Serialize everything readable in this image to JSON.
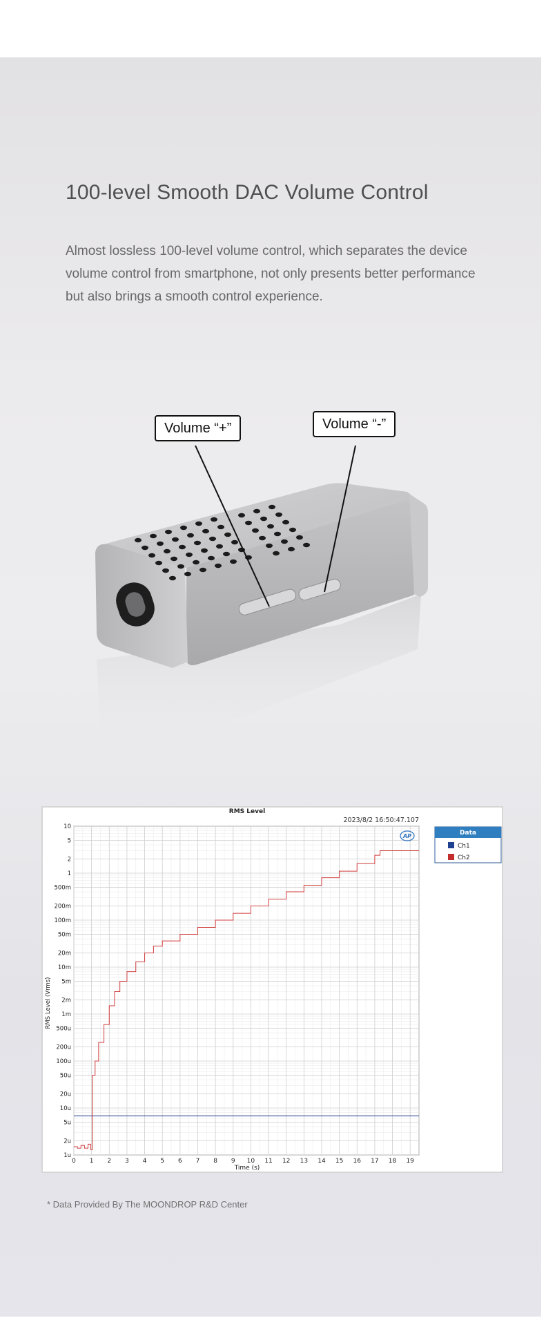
{
  "headline": "100-level Smooth DAC Volume Control",
  "description": "Almost lossless 100-level volume control, which separates the device volume control from smartphone, not only presents better performance but also brings a smooth control experience.",
  "callouts": {
    "plus": "Volume “+”",
    "minus": "Volume “-”"
  },
  "chart_data": {
    "type": "line",
    "title": "RMS Level",
    "timestamp": "2023/8/2 16:50:47.107",
    "xlabel": "Time (s)",
    "ylabel": "RMS Level (Vrms)",
    "xlim": [
      0,
      19.5
    ],
    "ylim": [
      1e-06,
      10
    ],
    "yscale": "log",
    "grid": true,
    "legend_title": "Data",
    "legend_position": "right",
    "x_ticks": [
      0,
      1,
      2,
      3,
      4,
      5,
      6,
      7,
      8,
      9,
      10,
      11,
      12,
      13,
      14,
      15,
      16,
      17,
      18,
      19
    ],
    "y_ticks": [
      {
        "v": 10,
        "l": "10"
      },
      {
        "v": 5,
        "l": "5"
      },
      {
        "v": 2,
        "l": "2"
      },
      {
        "v": 1,
        "l": "1"
      },
      {
        "v": 0.5,
        "l": "500m"
      },
      {
        "v": 0.2,
        "l": "200m"
      },
      {
        "v": 0.1,
        "l": "100m"
      },
      {
        "v": 0.05,
        "l": "50m"
      },
      {
        "v": 0.02,
        "l": "20m"
      },
      {
        "v": 0.01,
        "l": "10m"
      },
      {
        "v": 0.005,
        "l": "5m"
      },
      {
        "v": 0.002,
        "l": "2m"
      },
      {
        "v": 0.001,
        "l": "1m"
      },
      {
        "v": 0.0005,
        "l": "500u"
      },
      {
        "v": 0.0002,
        "l": "200u"
      },
      {
        "v": 0.0001,
        "l": "100u"
      },
      {
        "v": 5e-05,
        "l": "50u"
      },
      {
        "v": 2e-05,
        "l": "20u"
      },
      {
        "v": 1e-05,
        "l": "10u"
      },
      {
        "v": 5e-06,
        "l": "5u"
      },
      {
        "v": 2e-06,
        "l": "2u"
      },
      {
        "v": 1e-06,
        "l": "1u"
      }
    ],
    "series": [
      {
        "name": "Ch1",
        "color": "#1f3f8f",
        "x": [
          0,
          19.5
        ],
        "y": [
          6.8e-06,
          6.8e-06
        ]
      },
      {
        "name": "Ch2",
        "color": "#d03b3b",
        "x": [
          0,
          0.2,
          0.4,
          0.6,
          0.8,
          0.95,
          1.05,
          1.2,
          1.4,
          1.7,
          2.0,
          2.3,
          2.6,
          3.0,
          3.5,
          4.0,
          4.5,
          5.0,
          6.0,
          7.0,
          8.0,
          9.0,
          10.0,
          11.0,
          12.0,
          13.0,
          14.0,
          15.0,
          16.0,
          17.0,
          17.3,
          19.5
        ],
        "y": [
          1.5e-06,
          1.4e-06,
          1.6e-06,
          1.4e-06,
          1.7e-06,
          1.3e-06,
          5e-05,
          0.0001,
          0.00025,
          0.0006,
          0.0015,
          0.003,
          0.005,
          0.008,
          0.013,
          0.02,
          0.028,
          0.036,
          0.05,
          0.07,
          0.1,
          0.14,
          0.2,
          0.28,
          0.4,
          0.55,
          0.8,
          1.1,
          1.6,
          2.4,
          3.0,
          3.0
        ]
      }
    ]
  },
  "footnote": "* Data Provided By The MOONDROP R&D Center"
}
